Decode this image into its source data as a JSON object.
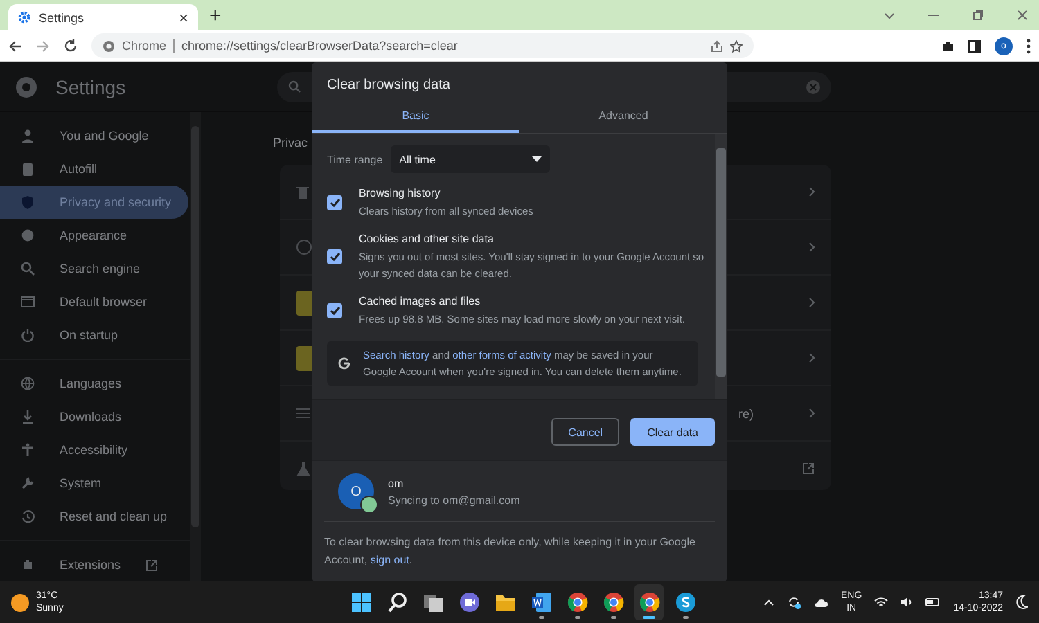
{
  "browser": {
    "tab": {
      "title": "Settings",
      "close": "×"
    },
    "new_tab": "+",
    "address": {
      "site_label": "Chrome",
      "url": "chrome://settings/clearBrowserData?search=clear"
    },
    "profile_initial": "o"
  },
  "settings": {
    "title": "Settings",
    "sidebar": [
      {
        "label": "You and Google",
        "selected": false,
        "kind": "link"
      },
      {
        "label": "Autofill",
        "selected": false,
        "kind": "link"
      },
      {
        "label": "Privacy and security",
        "selected": true,
        "kind": "link"
      },
      {
        "label": "Appearance",
        "selected": false,
        "kind": "link"
      },
      {
        "label": "Search engine",
        "selected": false,
        "kind": "link"
      },
      {
        "label": "Default browser",
        "selected": false,
        "kind": "link"
      },
      {
        "label": "On startup",
        "selected": false,
        "kind": "link"
      },
      {
        "label": "Languages",
        "selected": false,
        "kind": "link"
      },
      {
        "label": "Downloads",
        "selected": false,
        "kind": "link"
      },
      {
        "label": "Accessibility",
        "selected": false,
        "kind": "link"
      },
      {
        "label": "System",
        "selected": false,
        "kind": "link"
      },
      {
        "label": "Reset and clean up",
        "selected": false,
        "kind": "link"
      },
      {
        "label": "Extensions",
        "selected": false,
        "kind": "external"
      }
    ],
    "section_title": "Privac",
    "row_fragment": "re)"
  },
  "dialog": {
    "title": "Clear browsing data",
    "tabs": [
      {
        "label": "Basic",
        "selected": true
      },
      {
        "label": "Advanced",
        "selected": false
      }
    ],
    "time_range": {
      "label": "Time range",
      "value": "All time"
    },
    "options": [
      {
        "title": "Browsing history",
        "description": "Clears history from all synced devices",
        "checked": true
      },
      {
        "title": "Cookies and other site data",
        "description": "Signs you out of most sites. You'll stay signed in to your Google Account so your synced data can be cleared.",
        "checked": true
      },
      {
        "title": "Cached images and files",
        "description": "Frees up 98.8 MB. Some sites may load more slowly on your next visit.",
        "checked": true
      }
    ],
    "info": [
      {
        "text": "Search history",
        "link": true
      },
      {
        "text": " and ",
        "link": false
      },
      {
        "text": "other forms of activity",
        "link": true
      },
      {
        "text": " may be saved in your Google Account when you're signed in. You can delete them anytime.",
        "link": false
      }
    ],
    "buttons": [
      {
        "label": "Cancel",
        "kind": "secondary"
      },
      {
        "label": "Clear data",
        "kind": "primary"
      }
    ],
    "account": {
      "initial": "O",
      "name": "om",
      "status": "Syncing to om@gmail.com"
    },
    "footer": [
      {
        "text": "To clear browsing data from this device only, while keeping it in your Google Account, ",
        "link": false
      },
      {
        "text": "sign out",
        "link": true
      },
      {
        "text": ".",
        "link": false
      }
    ]
  },
  "taskbar": {
    "weather": {
      "temp": "31°C",
      "condition": "Sunny"
    },
    "apps": [
      {
        "kind": "start",
        "running": false,
        "selected": false
      },
      {
        "kind": "search",
        "running": false,
        "selected": false
      },
      {
        "kind": "taskview",
        "running": false,
        "selected": false
      },
      {
        "kind": "meet",
        "running": false,
        "selected": false
      },
      {
        "kind": "files",
        "running": false,
        "selected": false
      },
      {
        "kind": "word",
        "running": true,
        "selected": false
      },
      {
        "kind": "chrome",
        "running": true,
        "selected": false
      },
      {
        "kind": "chrome",
        "running": true,
        "selected": false
      },
      {
        "kind": "chrome",
        "running": true,
        "selected": true
      },
      {
        "kind": "skype",
        "running": true,
        "selected": false
      }
    ],
    "language": {
      "code": "ENG",
      "region": "IN"
    },
    "time": "13:47",
    "date": "14-10-2022"
  }
}
